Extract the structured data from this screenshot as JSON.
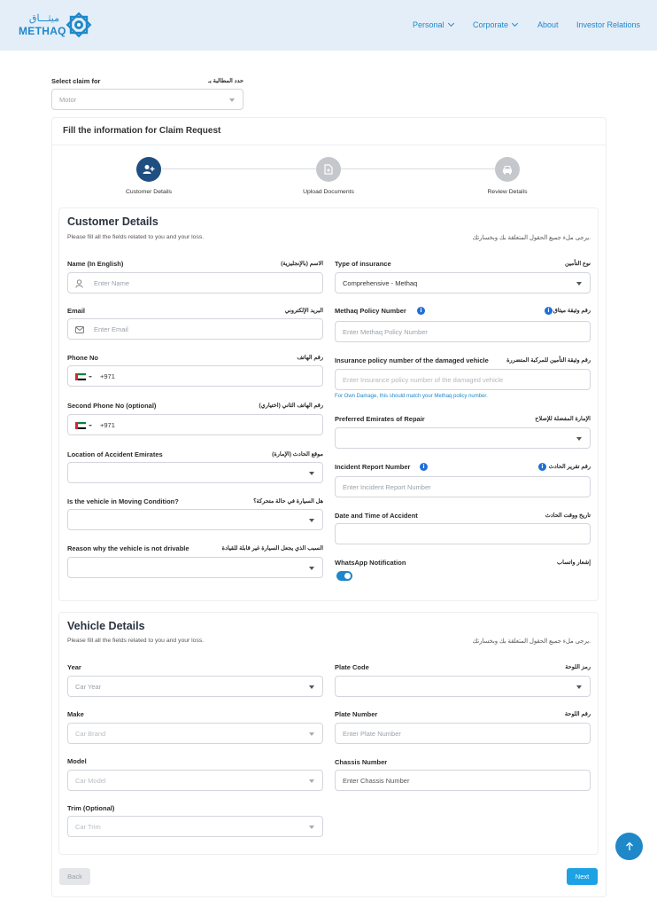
{
  "header": {
    "logo_ar": "ميثـــاق",
    "logo_en": "METHAQ",
    "nav": [
      "Personal",
      "Corporate",
      "About",
      "Investor Relations"
    ]
  },
  "select_claim": {
    "label": "Select claim for",
    "label_ar": "حدد المطالبة بـ",
    "value": "Motor"
  },
  "form_title": "Fill the information for Claim Request",
  "steps": [
    "Customer Details",
    "Upload Documents",
    "Review Details"
  ],
  "customer": {
    "title": "Customer Details",
    "subtitle": "Please fill all the fields related to you and your loss.",
    "subtitle_ar": "يرجى ملء جميع الحقول المتعلقة بك وبخسارتك.",
    "name_label": "Name (In English)",
    "name_label_ar": "الاسم (بالإنجليزية)",
    "name_placeholder": "Enter Name",
    "email_label": "Email",
    "email_label_ar": "البريد الإلكتروني",
    "email_placeholder": "Enter Email",
    "phone_label": "Phone No",
    "phone_label_ar": "رقم الهاتف",
    "phone_code": "+971",
    "phone2_label": "Second Phone No (optional)",
    "phone2_label_ar": "رقم الهاتف الثاني (اختياري)",
    "phone2_code": "+971",
    "location_label": "Location of Accident Emirates",
    "location_label_ar": "موقع الحادث (الإمارة)",
    "moving_label": "Is the vehicle in Moving Condition?",
    "moving_label_ar": "هل السيارة في حالة متحركة؟",
    "reason_label": "Reason why the vehicle is not drivable",
    "reason_label_ar": "السبب الذي يجعل السيارة غير قابلة للقيادة",
    "type_label": "Type of insurance",
    "type_label_ar": "نوع التأمين",
    "type_value": "Comprehensive - Methaq",
    "policy_label": "Methaq Policy Number",
    "policy_label_ar": "رقم وثيقة ميثاق",
    "policy_placeholder": "Enter Methaq Policy Number",
    "damaged_label": "Insurance policy number of the damaged vehicle",
    "damaged_label_ar": "رقم وثيقة التأمين للمركبة المتضررة",
    "damaged_placeholder": "Enter Insurance policy number of the damaged vehicle",
    "damaged_hint": "For Own Damage, this should match your Methaq policy number.",
    "repair_label": "Preferred Emirates of Repair",
    "repair_label_ar": "الإمارة المفضلة للإصلاح",
    "incident_label": "Incident Report Number",
    "incident_label_ar": "رقم تقرير الحادث",
    "incident_placeholder": "Enter Incident Report Number",
    "datetime_label": "Date and Time of Accident",
    "datetime_label_ar": "تاريخ ووقت الحادث",
    "whatsapp_label": "WhatsApp Notification",
    "whatsapp_label_ar": "إشعار واتساب",
    "whatsapp_on": true
  },
  "vehicle": {
    "title": "Vehicle Details",
    "subtitle": "Please fill all the fields related to you and your loss.",
    "subtitle_ar": "يرجى ملء جميع الحقول المتعلقة بك وبخسارتك.",
    "year_label": "Year",
    "year_placeholder": "Car Year",
    "make_label": "Make",
    "make_placeholder": "Car Brand",
    "model_label": "Model",
    "model_placeholder": "Car Model",
    "trim_label": "Trim (Optional)",
    "trim_placeholder": "Car Trim",
    "plate_code_label": "Plate Code",
    "plate_code_label_ar": "رمز اللوحة",
    "plate_number_label": "Plate Number",
    "plate_number_label_ar": "رقم اللوحة",
    "plate_number_placeholder": "Enter Plate Number",
    "chassis_label": "Chassis Number",
    "chassis_placeholder": "Enter Chassis Number"
  },
  "buttons": {
    "back": "Back",
    "next": "Next"
  },
  "colors": {
    "brand": "#1f88c8",
    "step_active": "#1e4f80",
    "step_inactive": "#c4c8cd",
    "next": "#1ea2e3",
    "info": "#1f6fd6"
  },
  "icons": [
    "methaq-logo-icon",
    "user-plus-icon",
    "document-icon",
    "car-icon",
    "user-icon",
    "mail-icon",
    "info-icon",
    "arrow-up-icon",
    "chevron-down-icon"
  ]
}
